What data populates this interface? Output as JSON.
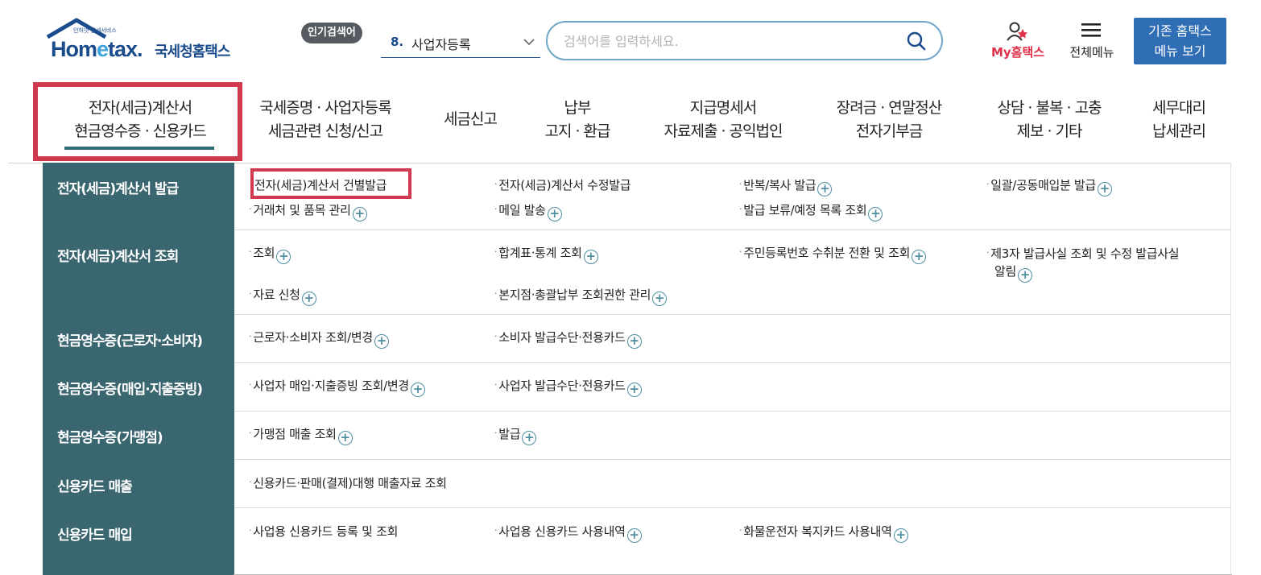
{
  "header": {
    "logo": {
      "tagline": "인허넷 납세서비스",
      "word_a": "Hom",
      "word_e": "e",
      "word_b": "tax.",
      "korean": "국세청홈택스"
    },
    "popular": {
      "badge": "인기검색어",
      "rank": "8.",
      "keyword": "사업자등록"
    },
    "search": {
      "placeholder": "검색어를 입력하세요."
    },
    "my_hometax": "My홈택스",
    "all_menu": "전체메뉴",
    "old_menu_button": [
      "기존 홈택스",
      "메뉴 보기"
    ]
  },
  "gnb": [
    {
      "lines": [
        "전자(세금)계산서",
        "현금영수증 · 신용카드"
      ],
      "active": true
    },
    {
      "lines": [
        "국세증명 · 사업자등록",
        "세금관련 신청/신고"
      ]
    },
    {
      "lines": [
        "세금신고"
      ]
    },
    {
      "lines": [
        "납부",
        "고지 · 환급"
      ]
    },
    {
      "lines": [
        "지급명세서",
        "자료제출 · 공익법인"
      ]
    },
    {
      "lines": [
        "장려금 · 연말정산",
        "전자기부금"
      ]
    },
    {
      "lines": [
        "상담 · 불복 · 고충",
        "제보 · 기타"
      ]
    },
    {
      "lines": [
        "세무대리",
        "납세관리"
      ]
    }
  ],
  "submenu": [
    {
      "category": "전자(세금)계산서 발급",
      "items": [
        {
          "label": "전자(세금)계산서 건별발급",
          "plus": false,
          "highlight": true
        },
        {
          "label": "전자(세금)계산서 수정발급",
          "plus": false
        },
        {
          "label": "반복/복사 발급",
          "plus": true
        },
        {
          "label": "일괄/공동매입분 발급",
          "plus": true
        },
        {
          "label": "거래처 및 품목 관리",
          "plus": true
        },
        {
          "label": "메일 발송",
          "plus": true
        },
        {
          "label": "발급 보류/예정 목록 조회",
          "plus": true
        }
      ]
    },
    {
      "category": "전자(세금)계산서 조회",
      "items": [
        {
          "label": "조회",
          "plus": true
        },
        {
          "label": "합계표·통계 조회",
          "plus": true
        },
        {
          "label": "주민등록번호 수취분 전환 및 조회",
          "plus": true
        },
        {
          "label": "제3자 발급사실 조회 및 수정 발급사실",
          "label2": "알림",
          "plus": true
        },
        {
          "label": "자료 신청",
          "plus": true
        },
        {
          "label": "본지점·총괄납부 조회권한 관리",
          "plus": true
        }
      ]
    },
    {
      "category": "현금영수증(근로자·소비자)",
      "items": [
        {
          "label": "근로자·소비자 조회/변경",
          "plus": true
        },
        {
          "label": "소비자 발급수단·전용카드",
          "plus": true
        }
      ]
    },
    {
      "category": "현금영수증(매입·지출증빙)",
      "items": [
        {
          "label": "사업자 매입·지출증빙 조회/변경",
          "plus": true
        },
        {
          "label": "사업자 발급수단·전용카드",
          "plus": true
        }
      ]
    },
    {
      "category": "현금영수증(가맹점)",
      "items": [
        {
          "label": "가맹점 매출 조회",
          "plus": true
        },
        {
          "label": "발급",
          "plus": true
        }
      ]
    },
    {
      "category": "신용카드 매출",
      "items": [
        {
          "label": "신용카드·판매(결제)대행 매출자료 조회",
          "plus": false
        }
      ]
    },
    {
      "category": "신용카드 매입",
      "items": [
        {
          "label": "사업용 신용카드 등록 및 조회",
          "plus": false
        },
        {
          "label": "사업용 신용카드 사용내역",
          "plus": true
        },
        {
          "label": "화물운전자 복지카드 사용내역",
          "plus": true
        }
      ]
    }
  ],
  "icons": {
    "search": "search-icon",
    "user": "user-icon",
    "menu": "hamburger-icon",
    "chevron": "chevron-down-icon",
    "plus": "plus-circle-icon"
  },
  "colors": {
    "brand": "#1a4b8d",
    "accent_red": "#d0394e",
    "sidebar": "#3a6670",
    "button": "#2f6db5"
  }
}
